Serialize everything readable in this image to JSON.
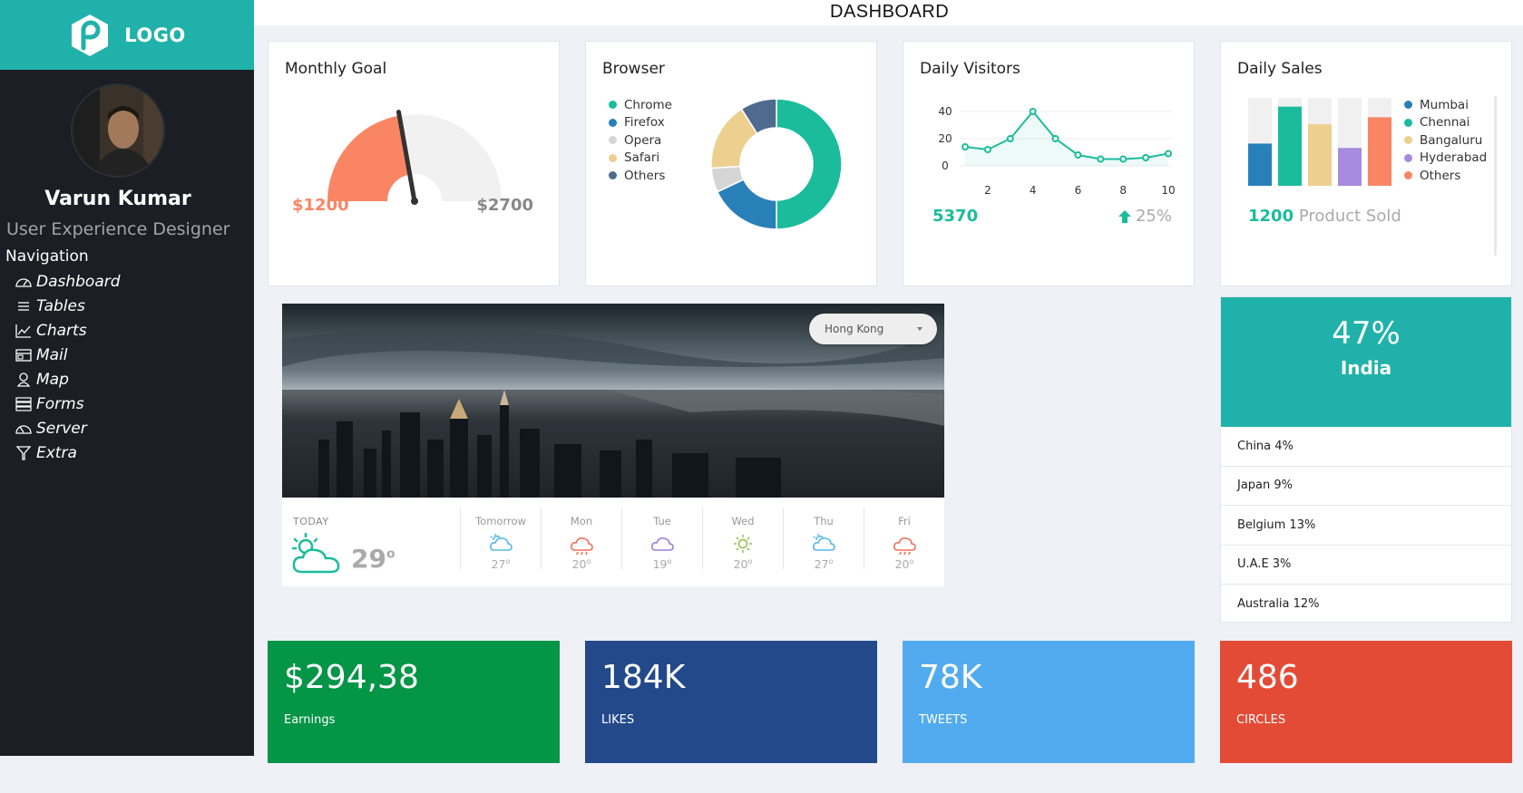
{
  "app": {
    "logo_text": "LOGO",
    "page_title": "DASHBOARD"
  },
  "user": {
    "name": "Varun Kumar",
    "role": "User Experience Designer"
  },
  "nav": {
    "heading": "Navigation",
    "items": [
      {
        "label": "Dashboard",
        "icon": "speedometer-icon"
      },
      {
        "label": "Tables",
        "icon": "list-icon"
      },
      {
        "label": "Charts",
        "icon": "line-chart-icon"
      },
      {
        "label": "Mail",
        "icon": "mail-icon"
      },
      {
        "label": "Map",
        "icon": "map-pin-icon"
      },
      {
        "label": "Forms",
        "icon": "forms-icon"
      },
      {
        "label": "Server",
        "icon": "server-icon"
      },
      {
        "label": "Extra",
        "icon": "funnel-icon"
      }
    ]
  },
  "monthly_goal": {
    "title": "Monthly Goal",
    "current": "$1200",
    "target": "$2700",
    "progress": 0.444,
    "color_fill": "#fa8564",
    "color_track": "#f1f1f1"
  },
  "browser": {
    "title": "Browser",
    "legend": [
      {
        "label": "Chrome",
        "color": "#1abc9c"
      },
      {
        "label": "Firefox",
        "color": "#2980b9"
      },
      {
        "label": "Opera",
        "color": "#d5d5d5"
      },
      {
        "label": "Safari",
        "color": "#edcf8e"
      },
      {
        "label": "Others",
        "color": "#4e6b8f"
      }
    ]
  },
  "daily_visitors": {
    "title": "Daily Visitors",
    "total": "5370",
    "change": "25%",
    "color": "#1abc9c"
  },
  "daily_sales": {
    "title": "Daily Sales",
    "count": "1200",
    "count_label": "Product Sold",
    "legend": [
      {
        "label": "Mumbai",
        "color": "#2980b9"
      },
      {
        "label": "Chennai",
        "color": "#1abc9c"
      },
      {
        "label": "Bangaluru",
        "color": "#edcf8e"
      },
      {
        "label": "Hyderabad",
        "color": "#a58add"
      },
      {
        "label": "Others",
        "color": "#fa8564"
      }
    ]
  },
  "weather": {
    "city": "Hong Kong",
    "today_label": "TODAY",
    "today_temp": "29",
    "days": [
      {
        "name": "Tomorrow",
        "temp": "27",
        "icon": "cloud-sun-icon",
        "color": "#58b7e8"
      },
      {
        "name": "Mon",
        "temp": "20",
        "icon": "rain-icon",
        "color": "#f0715a"
      },
      {
        "name": "Tue",
        "temp": "19",
        "icon": "cloud-icon",
        "color": "#9b7fd8"
      },
      {
        "name": "Wed",
        "temp": "20",
        "icon": "sun-icon",
        "color": "#8bc34a"
      },
      {
        "name": "Thu",
        "temp": "27",
        "icon": "cloud-sun-icon",
        "color": "#58b7e8"
      },
      {
        "name": "Fri",
        "temp": "20",
        "icon": "rain-icon",
        "color": "#f0715a"
      }
    ]
  },
  "country": {
    "top_pct": "47%",
    "top_name": "India",
    "list": [
      "China 4%",
      "Japan 9%",
      "Belgium 13%",
      "U.A.E 3%",
      "Australia 12%"
    ]
  },
  "tiles": [
    {
      "value": "$294,38",
      "label": "Earnings",
      "color": "#049546"
    },
    {
      "value": "184K",
      "label": "LIKES",
      "color": "#23498b"
    },
    {
      "value": "78K",
      "label": "TWEETS",
      "color": "#53abef"
    },
    {
      "value": "486",
      "label": "CIRCLES",
      "color": "#e34b36"
    }
  ],
  "chart_data": [
    {
      "type": "pie",
      "title": "Browser",
      "categories": [
        "Chrome",
        "Firefox",
        "Opera",
        "Safari",
        "Others"
      ],
      "values": [
        50,
        18,
        6,
        17,
        9
      ]
    },
    {
      "type": "line",
      "title": "Daily Visitors",
      "x": [
        1,
        2,
        3,
        4,
        5,
        6,
        7,
        8,
        9,
        10
      ],
      "series": [
        {
          "values": [
            14,
            12,
            20,
            40,
            20,
            8,
            5,
            5,
            6,
            9
          ]
        }
      ],
      "xticks": [
        "2",
        "4",
        "6",
        "8",
        "10"
      ],
      "yticks": [
        "0",
        "20",
        "40"
      ],
      "ylim": [
        0,
        40
      ],
      "xlim": [
        1,
        10
      ]
    },
    {
      "type": "bar",
      "title": "Daily Sales",
      "categories": [
        "Mumbai",
        "Chennai",
        "Bangaluru",
        "Hyderabad",
        "Others"
      ],
      "values": [
        48,
        90,
        70,
        43,
        78
      ],
      "ylim": [
        0,
        100
      ]
    }
  ]
}
